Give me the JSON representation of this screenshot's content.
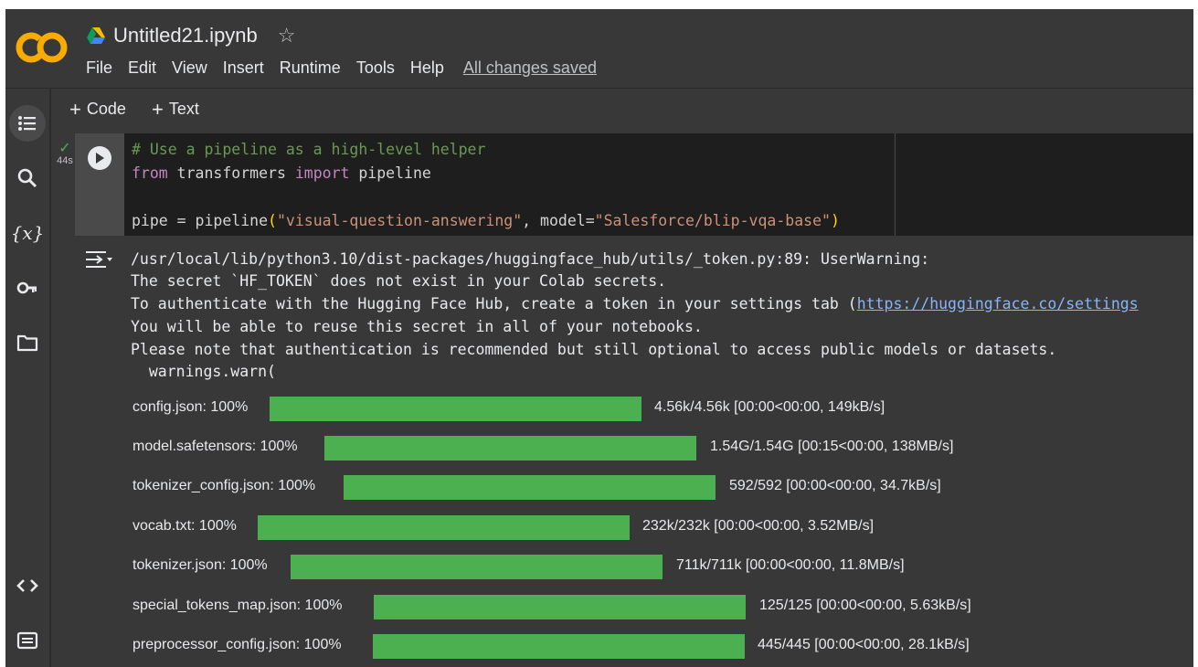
{
  "header": {
    "title": "Untitled21.ipynb",
    "logo_text": "CO",
    "drive_icon": "google-drive-icon",
    "star_icon": "star-outline-icon",
    "menu": [
      "File",
      "Edit",
      "View",
      "Insert",
      "Runtime",
      "Tools",
      "Help"
    ],
    "save_status": "All changes saved"
  },
  "sidebar": {
    "items": [
      {
        "icon": "table-of-contents-icon"
      },
      {
        "icon": "search-icon"
      },
      {
        "icon": "variables-icon",
        "label": "{x}"
      },
      {
        "icon": "secrets-key-icon"
      },
      {
        "icon": "folder-icon"
      },
      {
        "icon": "code-snippets-icon"
      },
      {
        "icon": "command-palette-icon"
      }
    ]
  },
  "toolbar": {
    "add_code": "Code",
    "add_text": "Text"
  },
  "cell": {
    "exec_time": "44s",
    "status_icon": "check-icon",
    "code": {
      "comment": "# Use a pipeline as a high-level helper",
      "kw_from": "from",
      "mod": " transformers ",
      "kw_import": "import",
      "imp": " pipeline",
      "l3_a": "pipe = pipeline",
      "l3_paren_open": "(",
      "l3_str1": "\"visual-question-answering\"",
      "l3_mid": ", model=",
      "l3_str2": "\"Salesforce/blip-vqa-base\"",
      "l3_paren_close": ")"
    }
  },
  "output": {
    "icon": "output-collapse-icon",
    "lines": [
      "/usr/local/lib/python3.10/dist-packages/huggingface_hub/utils/_token.py:89: UserWarning:",
      "The secret `HF_TOKEN` does not exist in your Colab secrets.",
      "To authenticate with the Hugging Face Hub, create a token in your settings tab (",
      "You will be able to reuse this secret in all of your notebooks.",
      "Please note that authentication is recommended but still optional to access public models or datasets.",
      "  warnings.warn("
    ],
    "link_text": "https://huggingface.co/settings",
    "progress": [
      {
        "label": "config.json: 100%",
        "fraction": 1.0,
        "stats": "4.56k/4.56k  [00:00<00:00,  149kB/s]"
      },
      {
        "label": "model.safetensors: 100%",
        "fraction": 1.0,
        "stats": "1.54G/1.54G  [00:15<00:00,  138MB/s]"
      },
      {
        "label": "tokenizer_config.json: 100%",
        "fraction": 1.0,
        "stats": "592/592  [00:00<00:00,  34.7kB/s]"
      },
      {
        "label": "vocab.txt: 100%",
        "fraction": 1.0,
        "stats": "232k/232k  [00:00<00:00,  3.52MB/s]"
      },
      {
        "label": "tokenizer.json: 100%",
        "fraction": 1.0,
        "stats": "711k/711k  [00:00<00:00,  11.8MB/s]"
      },
      {
        "label": "special_tokens_map.json: 100%",
        "fraction": 1.0,
        "stats": "125/125  [00:00<00:00,  5.63kB/s]"
      },
      {
        "label": "preprocessor_config.json: 100%",
        "fraction": 1.0,
        "stats": "445/445  [00:00<00:00,  28.1kB/s]"
      }
    ],
    "bar_color": "#4caf50"
  },
  "colors": {
    "logo_orange": "#f9ab00",
    "logo_dark": "#e37400",
    "background": "#383838",
    "code_bg": "#1e1e1e"
  }
}
